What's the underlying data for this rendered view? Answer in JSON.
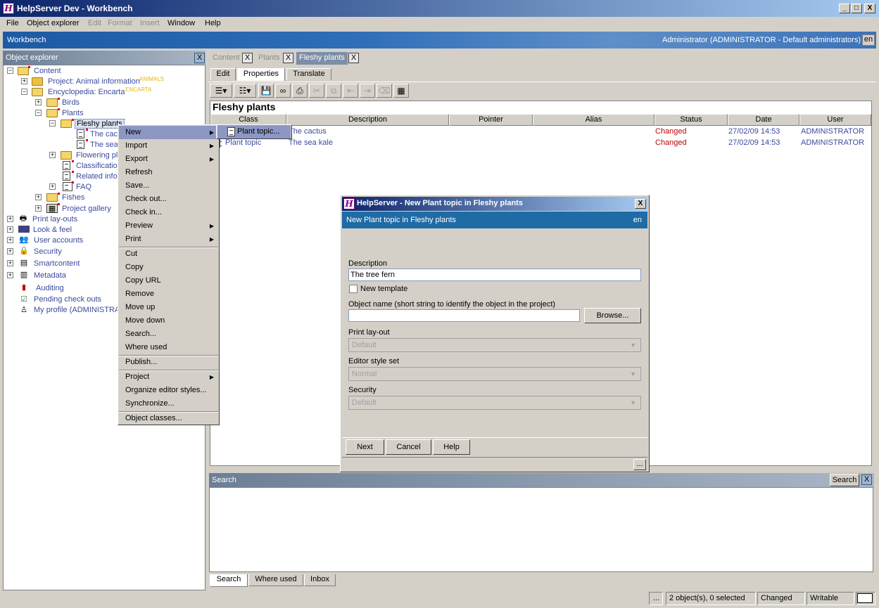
{
  "window": {
    "title": "HelpServer Dev - Workbench",
    "app_icon": "H",
    "minimize": "_",
    "maximize": "□",
    "close": "X"
  },
  "menu": {
    "file": "File",
    "object_explorer": "Object explorer",
    "edit": "Edit",
    "format": "Format",
    "insert": "Insert",
    "window": "Window",
    "help": "Help"
  },
  "header": {
    "title": "Workbench",
    "user": "Administrator (ADMINISTRATOR - Default administrators)",
    "lang": "en"
  },
  "explorer": {
    "title": "Object explorer",
    "close": "X",
    "tree": {
      "content": "Content",
      "project_animal": "Project: Animal information",
      "tag_animals": "ANIMALS",
      "encyclopedia": "Encyclopedia: Encarta",
      "tag_encarta": "ENCARTA",
      "birds": "Birds",
      "plants": "Plants",
      "fleshy": "Fleshy plants",
      "cactus_partial": "The cac",
      "sea_partial": "The sea",
      "flowering_partial": "Flowering pl",
      "classification_partial": "Classificatio",
      "related_partial": "Related infor",
      "faq": "FAQ",
      "fishes": "Fishes",
      "gallery": "Project gallery",
      "print_layouts": "Print lay-outs",
      "look_feel": "Look & feel",
      "user_accounts": "User accounts",
      "security": "Security",
      "smartcontent": "Smartcontent",
      "metadata": "Metadata",
      "auditing": "Auditing",
      "pending": "Pending check outs",
      "profile": "My profile (ADMINISTRAT"
    }
  },
  "tabs": {
    "content": "Content",
    "plants": "Plants",
    "fleshy": "Fleshy plants",
    "close": "X"
  },
  "subtabs": {
    "edit": "Edit",
    "properties": "Properties",
    "translate": "Translate"
  },
  "list": {
    "title": "Fleshy plants",
    "columns": [
      "Class",
      "Description",
      "Pointer",
      "Alias",
      "Status",
      "Date",
      "User"
    ],
    "rows": [
      {
        "class": "Plant topic",
        "description": "The cactus",
        "status": "Changed",
        "date": "27/02/09 14:53",
        "user": "ADMINISTRATOR"
      },
      {
        "class": "Plant topic",
        "description": "The sea kale",
        "status": "Changed",
        "date": "27/02/09 14:53",
        "user": "ADMINISTRATOR"
      }
    ]
  },
  "context_menu": {
    "new": "New",
    "import": "Import",
    "export": "Export",
    "refresh": "Refresh",
    "save": "Save...",
    "checkout": "Check out...",
    "checkin": "Check in...",
    "preview": "Preview",
    "print": "Print",
    "cut": "Cut",
    "copy": "Copy",
    "copy_url": "Copy URL",
    "remove": "Remove",
    "move_up": "Move up",
    "move_down": "Move down",
    "search": "Search...",
    "where_used": "Where used",
    "publish": "Publish...",
    "project": "Project",
    "organize": "Organize editor styles...",
    "synchronize": "Synchronize...",
    "object_classes": "Object classes...",
    "arrow": "▶"
  },
  "submenu": {
    "plant_topic": "Plant topic..."
  },
  "dialog": {
    "title": "HelpServer - New Plant topic in Fleshy plants",
    "banner": "New Plant topic in Fleshy plants",
    "lang": "en",
    "close": "X",
    "description_label": "Description",
    "description_value": "The tree fern",
    "new_template": "New template",
    "object_name_label": "Object name (short string to identify the object in the project)",
    "object_name_value": "",
    "browse": "Browse...",
    "print_layout_label": "Print lay-out",
    "print_layout_value": "Default",
    "style_set_label": "Editor style set",
    "style_set_value": "Normal",
    "security_label": "Security",
    "security_value": "Default",
    "dropdown_glyph": "▼",
    "next": "Next",
    "cancel": "Cancel",
    "help": "Help",
    "more": "..."
  },
  "search_panel": {
    "title": "Search",
    "search_button": "Search",
    "close": "X",
    "tabs": {
      "search": "Search",
      "where_used": "Where used",
      "inbox": "Inbox"
    }
  },
  "status": {
    "more": "...",
    "objects": "2 object(s), 0 selected",
    "changed": "Changed",
    "writable": "Writable"
  }
}
